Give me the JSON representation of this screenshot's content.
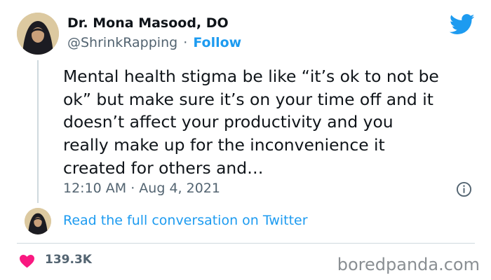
{
  "tweet": {
    "display_name": "Dr. Mona Masood, DO",
    "handle": "@ShrinkRapping",
    "separator": "·",
    "follow_label": "Follow",
    "text_lines": [
      "Mental health stigma be like “it’s ok to not be",
      "ok” but make sure it’s on your time off and it",
      "doesn’t affect your productivity and you",
      "really make up for the inconvenience it",
      "created for others and…"
    ],
    "timestamp": "12:10 AM · Aug 4, 2021",
    "read_conversation_label": "Read the full conversation on Twitter",
    "likes_count": "139.3K"
  },
  "watermark": "boredpanda.com",
  "icons": {
    "brand": "twitter-bird-icon",
    "info": "info-icon",
    "like": "heart-icon"
  },
  "colors": {
    "link": "#1d9bf0",
    "text": "#0f1419",
    "muted": "#536471",
    "heart": "#f91880",
    "divider": "#cfd9de",
    "watermark": "#8a8f93"
  }
}
